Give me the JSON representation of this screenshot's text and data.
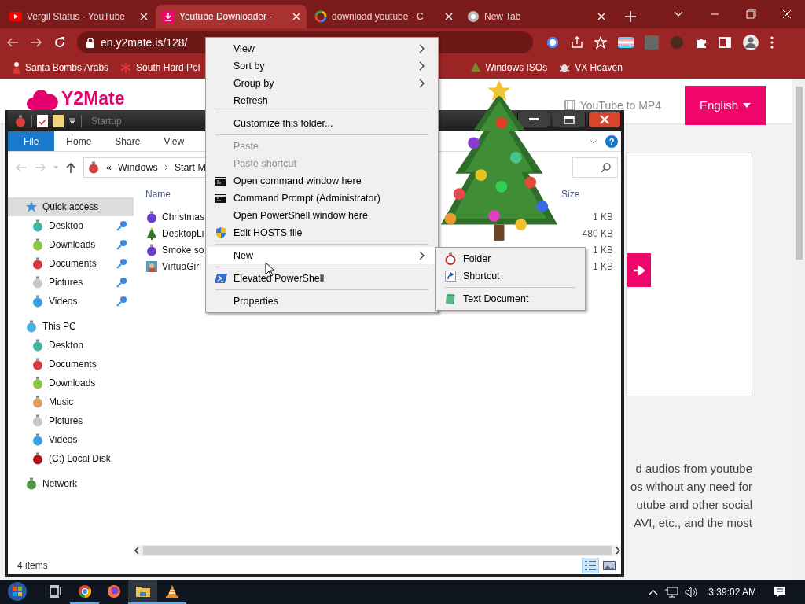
{
  "browser": {
    "tabs": [
      {
        "title": "Vergil Status - YouTube",
        "kind": "youtube",
        "selected": false
      },
      {
        "title": "Youtube Downloader -",
        "kind": "download",
        "selected": true
      },
      {
        "title": "download youtube - C",
        "kind": "google",
        "selected": false
      },
      {
        "title": "New Tab",
        "kind": "chrome",
        "selected": false
      }
    ],
    "url": "en.y2mate.is/128/",
    "bookmarks": [
      {
        "label": "Santa Bombs Arabs",
        "kind": "person"
      },
      {
        "label": "South Hard Pol",
        "kind": "snowflake"
      },
      {
        "label": "Windows ISOs",
        "kind": "tree"
      },
      {
        "label": "VX Heaven",
        "kind": "bug"
      }
    ],
    "page": {
      "logo": "Y2Mate",
      "nav_link": "YouTube to MP4",
      "language_button": "English",
      "paragraph_lines": [
        "d audios from youtube",
        "os without any need for",
        "utube and other social",
        "AVI, etc., and the most"
      ]
    }
  },
  "explorer": {
    "title": "Startup",
    "ribbon_tabs": [
      {
        "label": "File",
        "selected": true
      },
      {
        "label": "Home",
        "selected": false
      },
      {
        "label": "Share",
        "selected": false
      },
      {
        "label": "View",
        "selected": false
      }
    ],
    "help_button": "?",
    "path_prefix": "«",
    "path": [
      "Windows",
      "Start M"
    ],
    "columns": [
      "Name",
      "Size"
    ],
    "nav": [
      {
        "label": "Quick access",
        "kind": "star",
        "color": "#3b8fdc",
        "selected": true,
        "pinned": false,
        "children": [
          {
            "label": "Desktop",
            "kind": "ornament",
            "color": "#3fb5a5",
            "selected": false,
            "pinned": true
          },
          {
            "label": "Downloads",
            "kind": "ornament",
            "color": "#8cc63f",
            "selected": false,
            "pinned": true
          },
          {
            "label": "Documents",
            "kind": "ornament",
            "color": "#d63a3a",
            "selected": false,
            "pinned": true
          },
          {
            "label": "Pictures",
            "kind": "ornament",
            "color": "#c8c8c8",
            "selected": false,
            "pinned": true
          },
          {
            "label": "Videos",
            "kind": "ornament",
            "color": "#3aa0e0",
            "selected": false,
            "pinned": true
          }
        ]
      },
      {
        "label": "This PC",
        "kind": "ornament",
        "color": "#4ab0e0",
        "selected": false,
        "pinned": false,
        "children": [
          {
            "label": "Desktop",
            "kind": "ornament",
            "color": "#3fb5a5",
            "selected": false,
            "pinned": false
          },
          {
            "label": "Documents",
            "kind": "ornament",
            "color": "#d63a3a",
            "selected": false,
            "pinned": false
          },
          {
            "label": "Downloads",
            "kind": "ornament",
            "color": "#8cc63f",
            "selected": false,
            "pinned": false
          },
          {
            "label": "Music",
            "kind": "ornament",
            "color": "#d9a060",
            "selected": false,
            "pinned": false
          },
          {
            "label": "Pictures",
            "kind": "ornament",
            "color": "#c8c8c8",
            "selected": false,
            "pinned": false
          },
          {
            "label": "Videos",
            "kind": "ornament",
            "color": "#3aa0e0",
            "selected": false,
            "pinned": false
          },
          {
            "label": "(C:) Local Disk",
            "kind": "ornament",
            "color": "#b01818",
            "selected": false,
            "pinned": false
          }
        ]
      },
      {
        "label": "Network",
        "kind": "ornament",
        "color": "#4a9a40",
        "selected": false,
        "pinned": false
      }
    ],
    "files": [
      {
        "name": "Christmas",
        "size": "1 KB",
        "kind": "ornament"
      },
      {
        "name": "DesktopLi",
        "size": "480 KB",
        "kind": "tree"
      },
      {
        "name": "Smoke so",
        "size": "1 KB",
        "kind": "ornament"
      },
      {
        "name": "VirtuaGirl",
        "size": "1 KB",
        "kind": "image"
      }
    ],
    "status": "4 items",
    "views": [
      {
        "kind": "details",
        "selected": true
      },
      {
        "kind": "large-icons",
        "selected": false
      }
    ]
  },
  "context_menu": {
    "items": [
      {
        "kind": "plain",
        "label": "View",
        "disabled": false,
        "selected": false,
        "has_submenu": true
      },
      {
        "kind": "plain",
        "label": "Sort by",
        "disabled": false,
        "selected": false,
        "has_submenu": true
      },
      {
        "kind": "plain",
        "label": "Group by",
        "disabled": false,
        "selected": false,
        "has_submenu": true
      },
      {
        "kind": "plain",
        "label": "Refresh",
        "disabled": false,
        "selected": false,
        "has_submenu": false
      },
      {
        "kind": "separator"
      },
      {
        "kind": "plain",
        "label": "Customize this folder...",
        "disabled": false,
        "selected": false,
        "has_submenu": false
      },
      {
        "kind": "separator"
      },
      {
        "kind": "plain",
        "label": "Paste",
        "disabled": true,
        "selected": false,
        "has_submenu": false
      },
      {
        "kind": "plain",
        "label": "Paste shortcut",
        "disabled": true,
        "selected": false,
        "has_submenu": false
      },
      {
        "kind": "console",
        "label": "Open command window here",
        "disabled": false,
        "selected": false,
        "has_submenu": false
      },
      {
        "kind": "console",
        "label": "Command Prompt (Administrator)",
        "disabled": false,
        "selected": false,
        "has_submenu": false
      },
      {
        "kind": "plain",
        "label": "Open PowerShell window here",
        "disabled": false,
        "selected": false,
        "has_submenu": false
      },
      {
        "kind": "shield",
        "label": "Edit HOSTS file",
        "disabled": false,
        "selected": false,
        "has_submenu": false
      },
      {
        "kind": "separator"
      },
      {
        "kind": "plain",
        "label": "New",
        "disabled": false,
        "selected": true,
        "has_submenu": true
      },
      {
        "kind": "separator"
      },
      {
        "kind": "powershell",
        "label": "Elevated PowerShell",
        "disabled": false,
        "selected": false,
        "has_submenu": false
      },
      {
        "kind": "separator"
      },
      {
        "kind": "plain",
        "label": "Properties",
        "disabled": false,
        "selected": false,
        "has_submenu": false
      }
    ]
  },
  "submenu": {
    "items": [
      {
        "kind": "folder",
        "label": "Folder"
      },
      {
        "kind": "shortcut",
        "label": "Shortcut"
      },
      {
        "kind": "separator"
      },
      {
        "kind": "text-document",
        "label": "Text Document"
      }
    ]
  },
  "taskbar": {
    "apps": [
      {
        "kind": "task-view",
        "running": false,
        "selected": false
      },
      {
        "kind": "chrome",
        "running": true,
        "selected": false
      },
      {
        "kind": "firefox",
        "running": false,
        "selected": false
      },
      {
        "kind": "explorer",
        "running": true,
        "selected": true
      },
      {
        "kind": "vlc",
        "running": true,
        "selected": false
      }
    ],
    "clock": "3:39:02 AM"
  }
}
